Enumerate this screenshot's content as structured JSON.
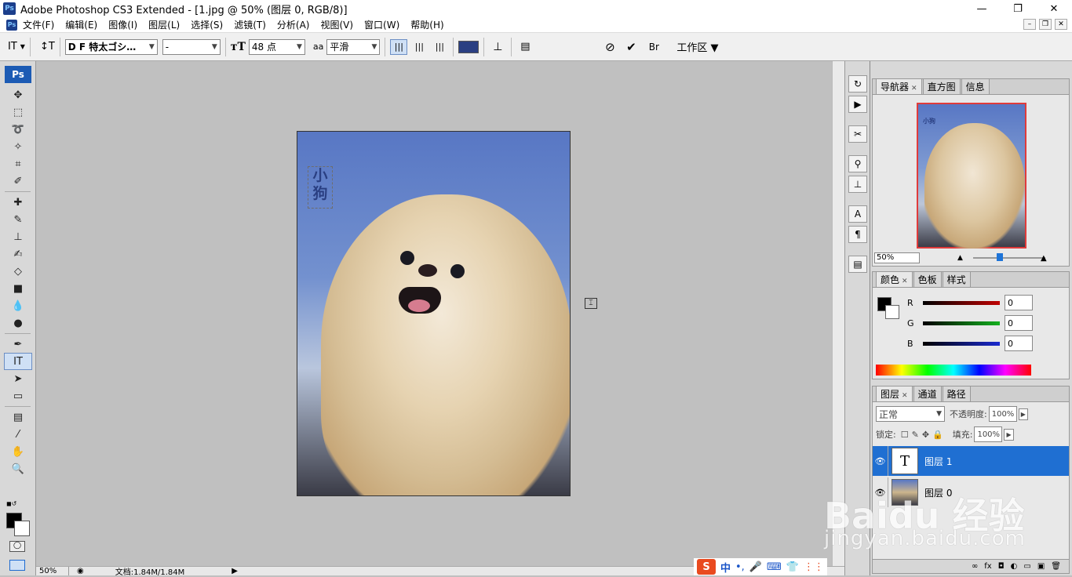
{
  "window": {
    "title": "Adobe Photoshop CS3 Extended - [1.jpg @ 50% (图层 0, RGB/8)]",
    "logo": "Ps",
    "minimize": "—",
    "restore": "❐",
    "close": "✕"
  },
  "menu": {
    "items": [
      "文件(F)",
      "编辑(E)",
      "图像(I)",
      "图层(L)",
      "选择(S)",
      "滤镜(T)",
      "分析(A)",
      "视图(V)",
      "窗口(W)",
      "帮助(H)"
    ]
  },
  "options": {
    "tool_icon": "IT",
    "orient_icon": "↕T",
    "font_family": "D F 特太ゴシ…",
    "font_style": "-",
    "font_size": "48 点",
    "aa_label": "aa",
    "aa_mode": "平滑",
    "workspace": "工作区",
    "text_color": "#2a3f82"
  },
  "toolbox": {
    "badge": "Ps"
  },
  "document": {
    "text_layer_text": [
      "小",
      "狗"
    ],
    "zoom": "50%",
    "doc_info": "文档:1.84M/1.84M"
  },
  "navigator": {
    "tabs": [
      "导航器",
      "直方图",
      "信息"
    ],
    "zoom": "50%",
    "thumb_text": "小狗"
  },
  "color": {
    "tabs": [
      "颜色",
      "色板",
      "样式"
    ],
    "channels": [
      {
        "label": "R",
        "value": "0",
        "color": "#c00000"
      },
      {
        "label": "G",
        "value": "0",
        "color": "#14b01e"
      },
      {
        "label": "B",
        "value": "0",
        "color": "#1a2ad0"
      }
    ]
  },
  "layers": {
    "tabs": [
      "图层",
      "通道",
      "路径"
    ],
    "blend_mode": "正常",
    "opacity_label": "不透明度:",
    "opacity_value": "100%",
    "lock_label": "锁定:",
    "fill_label": "填充:",
    "fill_value": "100%",
    "rows": [
      {
        "name": "图层 1",
        "thumb": "T",
        "selected": true
      },
      {
        "name": "图层 0",
        "thumb": "",
        "selected": false
      }
    ],
    "footer_icons": [
      "∞",
      "fx",
      "◘",
      "◐",
      "▭",
      "▣",
      "🗑"
    ]
  },
  "watermark": {
    "main": "Baidu 经验",
    "sub": "jingyan.baidu.com"
  },
  "ime": {
    "logo": "S",
    "items": [
      "中",
      "•,",
      "🎤",
      "⌨",
      "👕",
      "⋮⋮"
    ]
  }
}
